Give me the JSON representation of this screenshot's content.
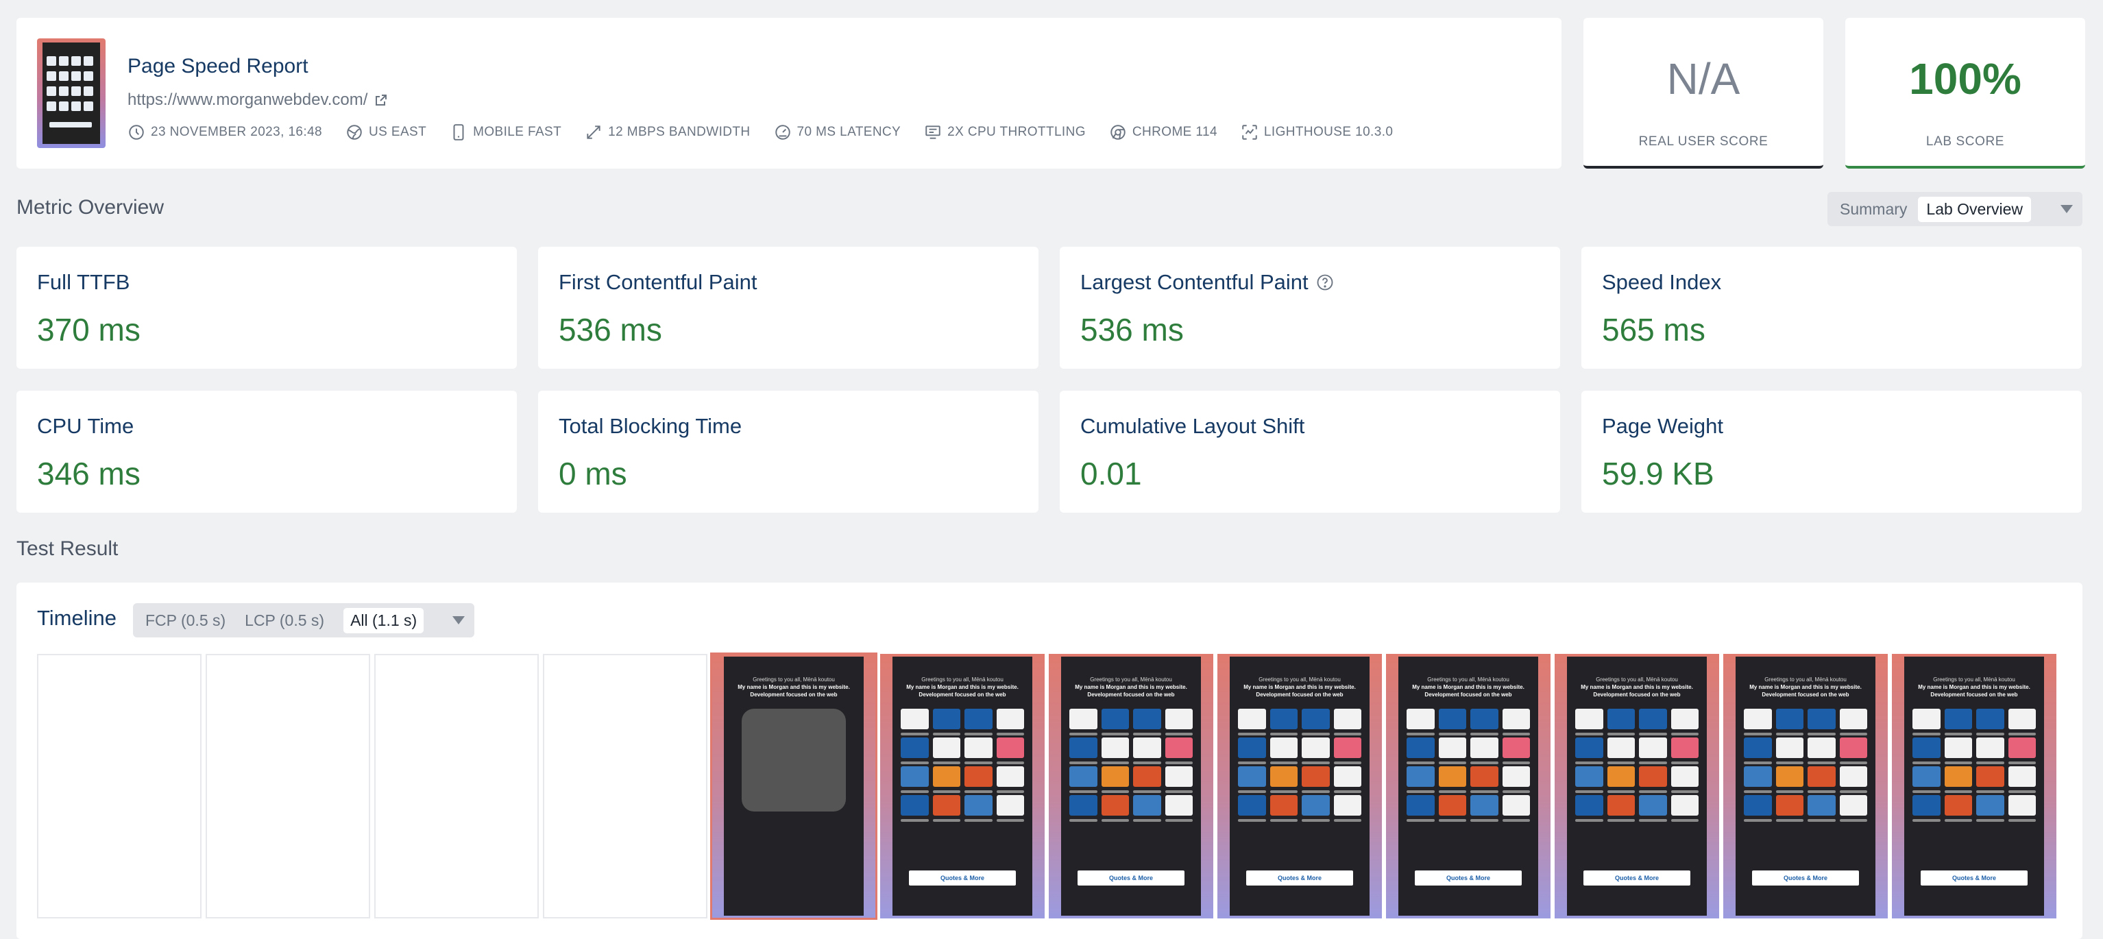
{
  "header": {
    "title": "Page Speed Report",
    "url": "https://www.morganwebdev.com/",
    "meta": [
      {
        "icon": "clock-icon",
        "text": "23 NOVEMBER 2023, 16:48"
      },
      {
        "icon": "globe-icon",
        "text": "US EAST"
      },
      {
        "icon": "mobile-icon",
        "text": "MOBILE FAST"
      },
      {
        "icon": "bandwidth-icon",
        "text": "12 MBPS BANDWIDTH"
      },
      {
        "icon": "gauge-icon",
        "text": "70 MS LATENCY"
      },
      {
        "icon": "cpu-icon",
        "text": "2X CPU THROTTLING"
      },
      {
        "icon": "chrome-icon",
        "text": "CHROME 114"
      },
      {
        "icon": "lighthouse-icon",
        "text": "LIGHTHOUSE 10.3.0"
      }
    ]
  },
  "scores": {
    "real_user": {
      "value": "N/A",
      "label": "REAL USER SCORE"
    },
    "lab": {
      "value": "100%",
      "label": "LAB SCORE",
      "color": "#2f7d3d"
    }
  },
  "metric_overview": {
    "title": "Metric Overview",
    "toggle": {
      "options": [
        "Summary",
        "Lab Overview"
      ],
      "active": "Lab Overview"
    },
    "metrics": [
      {
        "label": "Full TTFB",
        "value": "370 ms"
      },
      {
        "label": "First Contentful Paint",
        "value": "536 ms"
      },
      {
        "label": "Largest Contentful Paint",
        "value": "536 ms",
        "help": true
      },
      {
        "label": "Speed Index",
        "value": "565 ms"
      },
      {
        "label": "CPU Time",
        "value": "346 ms"
      },
      {
        "label": "Total Blocking Time",
        "value": "0 ms"
      },
      {
        "label": "Cumulative Layout Shift",
        "value": "0.01"
      },
      {
        "label": "Page Weight",
        "value": "59.9 KB"
      }
    ]
  },
  "test_result": {
    "title": "Test Result",
    "timeline": {
      "label": "Timeline",
      "filters": [
        "FCP (0.5 s)",
        "LCP (0.5 s)",
        "All (1.1 s)"
      ],
      "active_filter": "All (1.1 s)"
    },
    "frames": {
      "greeting": "Greetings to you all, Mēnā koutou",
      "headline": "My name is Morgan and this is my website. Development focused on the web",
      "button": "Quotes & More"
    }
  },
  "colors": {
    "good": "#2f7d3d",
    "accent": "#163a63"
  }
}
